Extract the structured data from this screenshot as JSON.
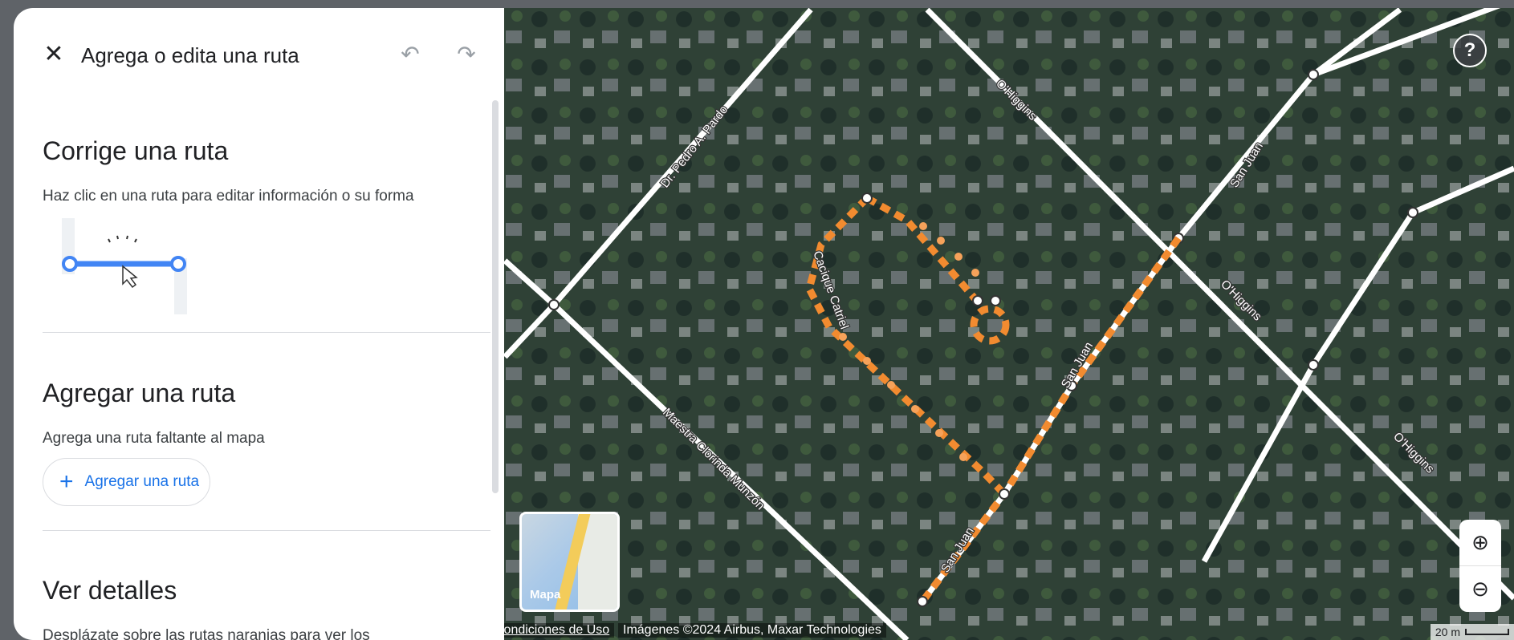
{
  "header": {
    "title": "Agrega o edita una ruta",
    "close_icon": "close-icon",
    "undo_icon": "undo-icon",
    "redo_icon": "redo-icon"
  },
  "sections": {
    "fix": {
      "title": "Corrige una ruta",
      "description": "Haz clic en una ruta para editar información o su forma"
    },
    "add": {
      "title": "Agregar una ruta",
      "description": "Agrega una ruta faltante al mapa",
      "button_label": "Agregar una ruta",
      "button_icon": "+"
    },
    "details": {
      "title": "Ver detalles",
      "description": "Desplázate sobre las rutas naranjas para ver los"
    }
  },
  "map": {
    "street_labels": {
      "pardo": "Dr. Pedro A. Pardo",
      "ohiggins": "O'Higgins",
      "sanjuan": "San Juan",
      "catriel": "Cacique Catriel",
      "munzon": "Maestra Clorinda Munzón"
    },
    "help_label": "?",
    "layer_label": "Mapa",
    "terms": "Condiciones de Uso",
    "copyright": "Imágenes ©2024 Airbus, Maxar Technologies",
    "scale": "20 m",
    "route_color": "#f28b30"
  }
}
